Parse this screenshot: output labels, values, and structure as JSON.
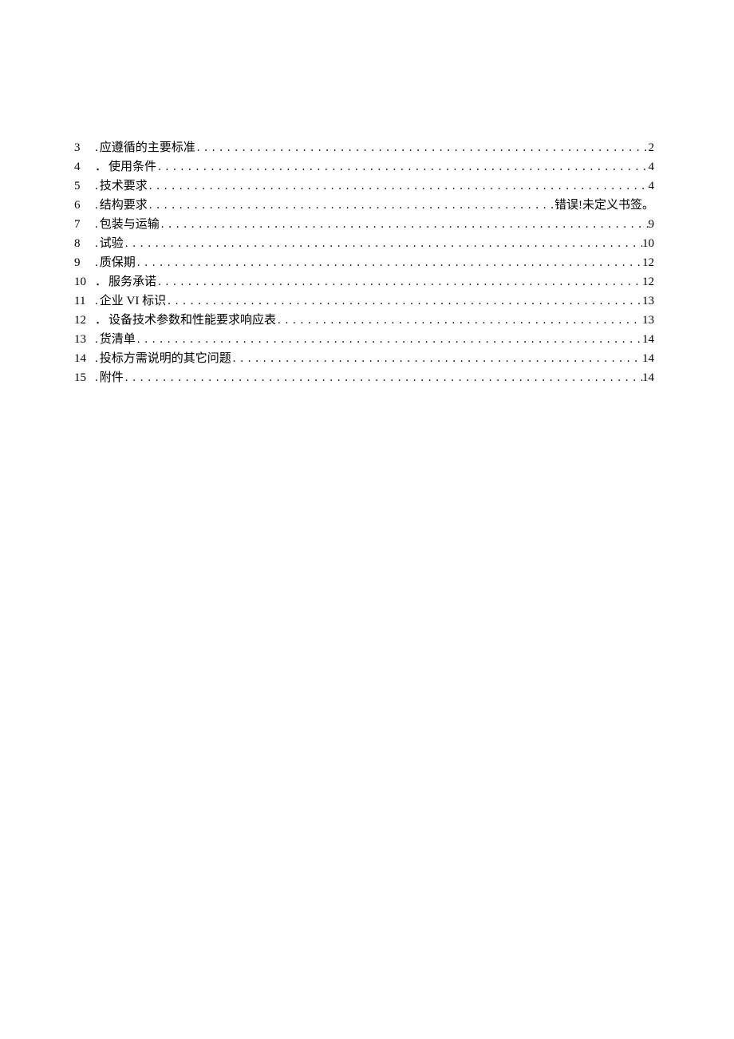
{
  "toc": {
    "entries": [
      {
        "num": "3",
        "sep": ".",
        "title": "应遵循的主要标准",
        "page": "2"
      },
      {
        "num": "4",
        "sep": "．",
        "title": "使用条件",
        "page": "4"
      },
      {
        "num": "5",
        "sep": ".",
        "title": "技术要求",
        "page": "4"
      },
      {
        "num": "6",
        "sep": ".",
        "title": "结构要求",
        "page": "错误!未定义书签。",
        "page_cn": true
      },
      {
        "num": "7",
        "sep": ".",
        "title": "包装与运输",
        "page": "9"
      },
      {
        "num": "8",
        "sep": ".",
        "title": "试验",
        "page": "10"
      },
      {
        "num": "9",
        "sep": ".",
        "title": "质保期",
        "page": "12"
      },
      {
        "num": "10",
        "sep": "．",
        "title": "服务承诺",
        "page": "12"
      },
      {
        "num": "11",
        "sep": ".",
        "title": "企业 VI 标识",
        "page": "13"
      },
      {
        "num": "12",
        "sep": "．",
        "title": "设备技术参数和性能要求响应表",
        "page": "13"
      },
      {
        "num": "13",
        "sep": ".",
        "title": "货清单",
        "page": "14"
      },
      {
        "num": "14",
        "sep": ".",
        "title": "投标方需说明的其它问题",
        "page": "14"
      },
      {
        "num": "15",
        "sep": ".",
        "title": "附件",
        "page": "14"
      }
    ]
  }
}
